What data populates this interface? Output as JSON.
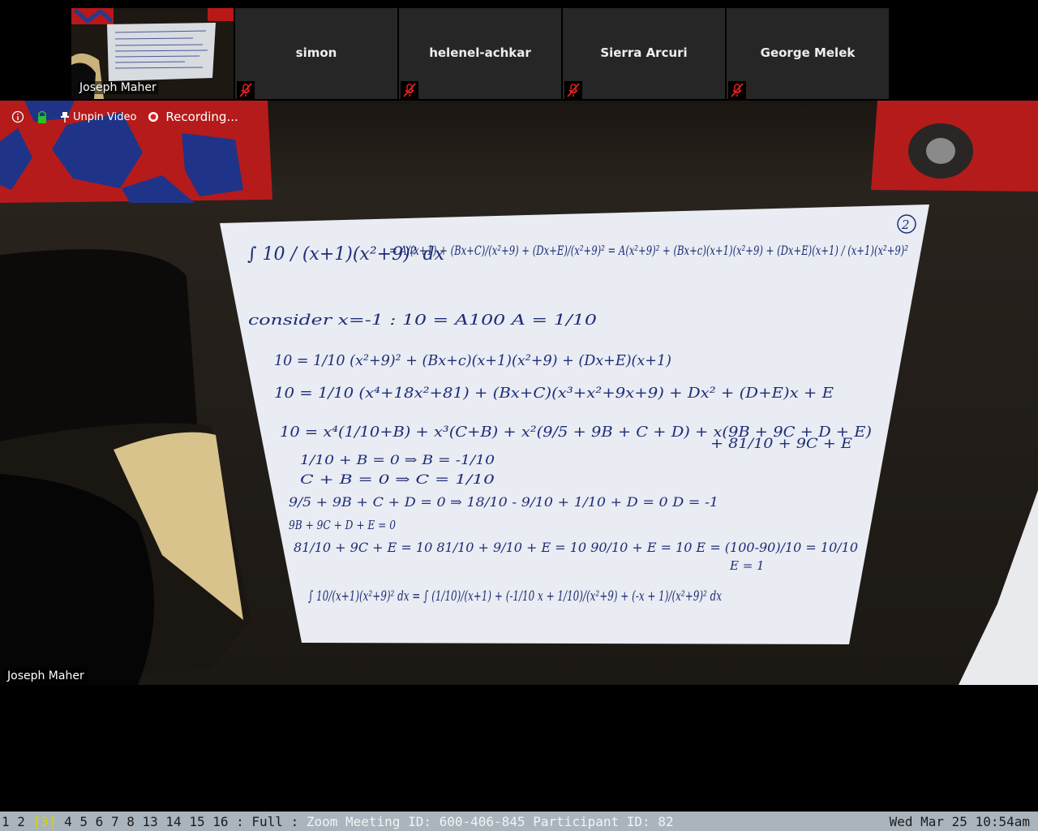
{
  "participants": [
    {
      "name": "simon",
      "muted": true
    },
    {
      "name": "helenel-achkar",
      "muted": true
    },
    {
      "name": "Sierra Arcuri",
      "muted": true
    },
    {
      "name": "George Melek",
      "muted": true
    }
  ],
  "self_view": {
    "name": "Joseph Maher"
  },
  "toolbar": {
    "info_icon": "info-icon",
    "lock_icon": "lock-icon",
    "unpin_label": "Unpin Video",
    "recording_label": "Recording..."
  },
  "main_video": {
    "speaker_name": "Joseph Maher"
  },
  "whiteboard": {
    "line1_lhs": "∫ 10 / (x+1)(x²+9)² dx",
    "line1_rhs": "= A/(x+1) + (Bx+C)/(x²+9) + (Dx+E)/(x²+9)² = A(x²+9)² + (Bx+c)(x+1)(x²+9) + (Dx+E)(x+1) / (x+1)(x²+9)²",
    "page_number": "2",
    "line2": "consider x=-1 :    10 = A100      A = 1/10",
    "line3": "10 = 1/10 (x²+9)² + (Bx+c)(x+1)(x²+9) + (Dx+E)(x+1)",
    "line4": "10 = 1/10 (x⁴+18x²+81) + (Bx+C)(x³+x²+9x+9) + Dx² + (D+E)x + E",
    "line5": "10 = x⁴(1/10+B) + x³(C+B) + x²(9/5 + 9B + C + D) + x(9B + 9C + D + E)",
    "line5b": "+ 81/10 + 9C + E",
    "line6": "1/10 + B = 0   ⇒   B = -1/10",
    "line7": "C + B = 0   ⇒   C = 1/10",
    "line8": "9/5 + 9B + C + D = 0   ⇒   18/10 - 9/10 + 1/10 + D = 0      D = -1",
    "line9": "9B + 9C + D + E = 0",
    "line10": "81/10 + 9C + E = 10      81/10 + 9/10 + E = 10      90/10 + E = 10      E = (100-90)/10 = 10/10",
    "line10b": "E = 1",
    "line11": "∫ 10/(x+1)(x²+9)² dx = ∫ (1/10)/(x+1) + (-1/10 x + 1/10)/(x²+9) + (-x + 1)/(x²+9)² dx"
  },
  "status_bar": {
    "workspaces": [
      "1",
      "2",
      "[3]",
      "4",
      "5",
      "6",
      "7",
      "8",
      "13",
      "14",
      "15",
      "16"
    ],
    "mode": ": Full :",
    "window_title": "Zoom Meeting ID: 600-406-845 Participant ID: 82",
    "clock": "Wed Mar 25 10:54am"
  },
  "colors": {
    "tile_bg": "#262626",
    "status_bar_bg": "#aab4bc",
    "active_workspace": "#d6d600",
    "ink": "#1e2d78",
    "muted_icon": "#e02020",
    "lock_green": "#28c228",
    "record_red": "#e02020"
  }
}
